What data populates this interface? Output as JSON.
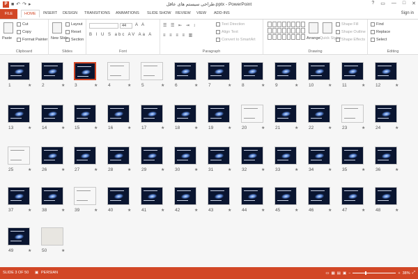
{
  "window": {
    "title": "طراحی سیستم های عاقل.pptx - PowerPoint",
    "controls": [
      "?",
      "▭",
      "—",
      "□",
      "✕"
    ],
    "qat": [
      "↶",
      "↷",
      "▸"
    ]
  },
  "tabs": [
    "FILE",
    "HOME",
    "INSERT",
    "DESIGN",
    "TRANSITIONS",
    "ANIMATIONS",
    "SLIDE SHOW",
    "REVIEW",
    "VIEW",
    "ADD-INS"
  ],
  "active_tab": "HOME",
  "signin": "Sign in",
  "ribbon": {
    "clipboard": {
      "label": "Clipboard",
      "paste": "Paste",
      "cut": "Cut",
      "copy": "Copy",
      "format_painter": "Format Painter"
    },
    "slides": {
      "label": "Slides",
      "new_slide": "New Slide",
      "layout": "Layout",
      "reset": "Reset",
      "section": "Section"
    },
    "font": {
      "label": "Font",
      "size": "44",
      "format_row": "B I U S abc AV Aa A",
      "size_row": "A A"
    },
    "paragraph": {
      "label": "Paragraph",
      "text_direction": "Text Direction",
      "align_text": "Align Text",
      "convert_smartart": "Convert to SmartArt"
    },
    "drawing": {
      "label": "Drawing",
      "arrange": "Arrange",
      "quick_styles": "Quick Styles",
      "shape_fill": "Shape Fill",
      "shape_outline": "Shape Outline",
      "shape_effects": "Shape Effects"
    },
    "editing": {
      "label": "Editing",
      "find": "Find",
      "replace": "Replace",
      "select": "Select"
    }
  },
  "slides": {
    "count": 50,
    "selected": 3,
    "white": [
      4,
      5,
      20,
      23,
      25,
      39
    ],
    "photo": [
      50
    ],
    "star": "★"
  },
  "status": {
    "slide_info": "SLIDE 3 OF 50",
    "language": "PERSIAN",
    "zoom": "38%"
  }
}
